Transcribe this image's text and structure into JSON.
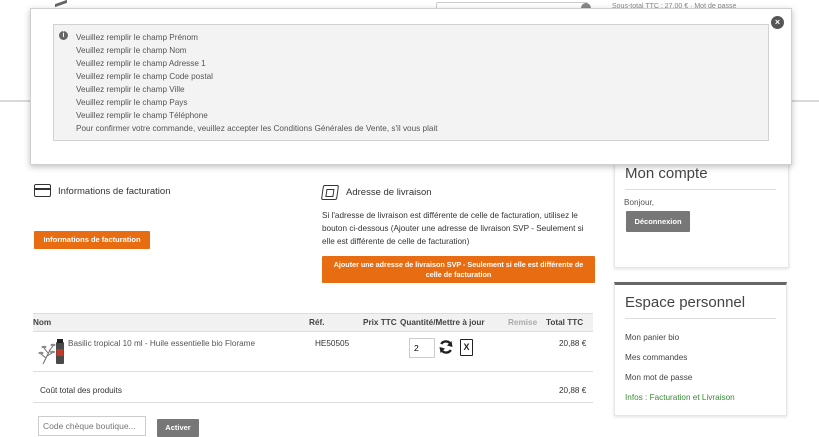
{
  "header": {
    "cart_summary": "Sous-total TTC : 27,00 € · Mot de passe"
  },
  "modal": {
    "messages": [
      "Veuillez remplir le champ Prénom",
      "Veuillez remplir le champ Nom",
      "Veuillez remplir le champ Adresse 1",
      "Veuillez remplir le champ Code postal",
      "Veuillez remplir le champ Ville",
      "Veuillez remplir le champ Pays",
      "Veuillez remplir le champ Téléphone",
      "Pour confirmer votre commande, veuillez accepter les Conditions Générales de Vente, s'il vous plait"
    ],
    "close_glyph": "×",
    "info_glyph": "i"
  },
  "billing": {
    "title": "Informations de facturation",
    "button_label": "Informations de facturation"
  },
  "shipping": {
    "title": "Adresse de livraison",
    "text": "Si l'adresse de livraison est différente de celle de facturation, utilisez le bouton ci-dessous (Ajouter une adresse de livraison SVP - Seulement si elle est différente de celle de facturation)",
    "button_label": "Ajouter une adresse de livraison SVP - Seulement si elle est différente de celle de facturation"
  },
  "cart_table": {
    "headers": {
      "name": "Nom",
      "ref": "Réf.",
      "price": "Prix TTC",
      "qty": "Quantité/Mettre à jour",
      "discount": "Remise",
      "total": "Total TTC"
    },
    "rows": [
      {
        "name": "Basilic tropical 10 ml - Huile essentielle bio Florame",
        "ref": "HE50505",
        "qty": "2",
        "total": "20,88 €"
      }
    ],
    "total_label": "Coût total des produits",
    "total_value": "20,88 €",
    "delete_glyph": "X"
  },
  "coupon": {
    "placeholder": "Code chèque boutique...",
    "button_label": "Activer"
  },
  "account_panel": {
    "title": "Mon compte",
    "greeting": "Bonjour,",
    "logout_label": "Déconnexion"
  },
  "space_panel": {
    "title": "Espace personnel",
    "links": [
      "Mon panier bio",
      "Mes commandes",
      "Mon mot de passe",
      "Infos : Facturation et Livraison"
    ]
  },
  "colors": {
    "accent_orange": "#e86d12",
    "button_grey": "#777777",
    "link_green": "#3a8a3a"
  }
}
